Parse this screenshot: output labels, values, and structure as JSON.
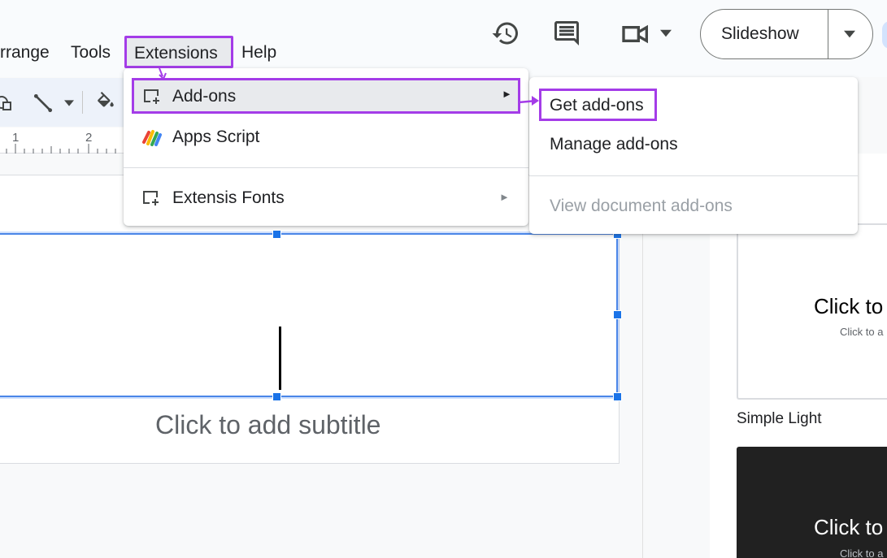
{
  "menubar": {
    "items": [
      "rrange",
      "Tools",
      "Extensions",
      "Help"
    ]
  },
  "header": {
    "slideshow_label": "Slideshow"
  },
  "ruler": {
    "marks": [
      "1",
      "2"
    ]
  },
  "extensions_menu": {
    "items": [
      {
        "label": "Add-ons",
        "icon": "add-on-icon",
        "has_submenu": true,
        "highlighted": true
      },
      {
        "label": "Apps Script",
        "icon": "apps-script-icon",
        "has_submenu": false
      },
      {
        "label": "Extensis Fonts",
        "icon": "add-on-icon",
        "has_submenu": true
      }
    ],
    "submenu_arrow": "►"
  },
  "addons_submenu": {
    "items": [
      {
        "label": "Get add-ons",
        "enabled": true,
        "highlighted": true
      },
      {
        "label": "Manage add-ons",
        "enabled": true
      },
      {
        "label": "View document add-ons",
        "enabled": false
      }
    ]
  },
  "slide": {
    "subtitle_placeholder": "Click to add subtitle"
  },
  "themes_panel": {
    "light_theme": {
      "title_preview": "Click to",
      "subtitle_preview": "Click to a",
      "name": "Simple Light"
    },
    "dark_theme": {
      "title_preview": "Click to",
      "subtitle_preview": "Click to a"
    }
  },
  "colors": {
    "highlight_border": "#a43ce8",
    "selection_blue": "#1a73e8",
    "menu_highlight_bg": "#e8eaed"
  }
}
